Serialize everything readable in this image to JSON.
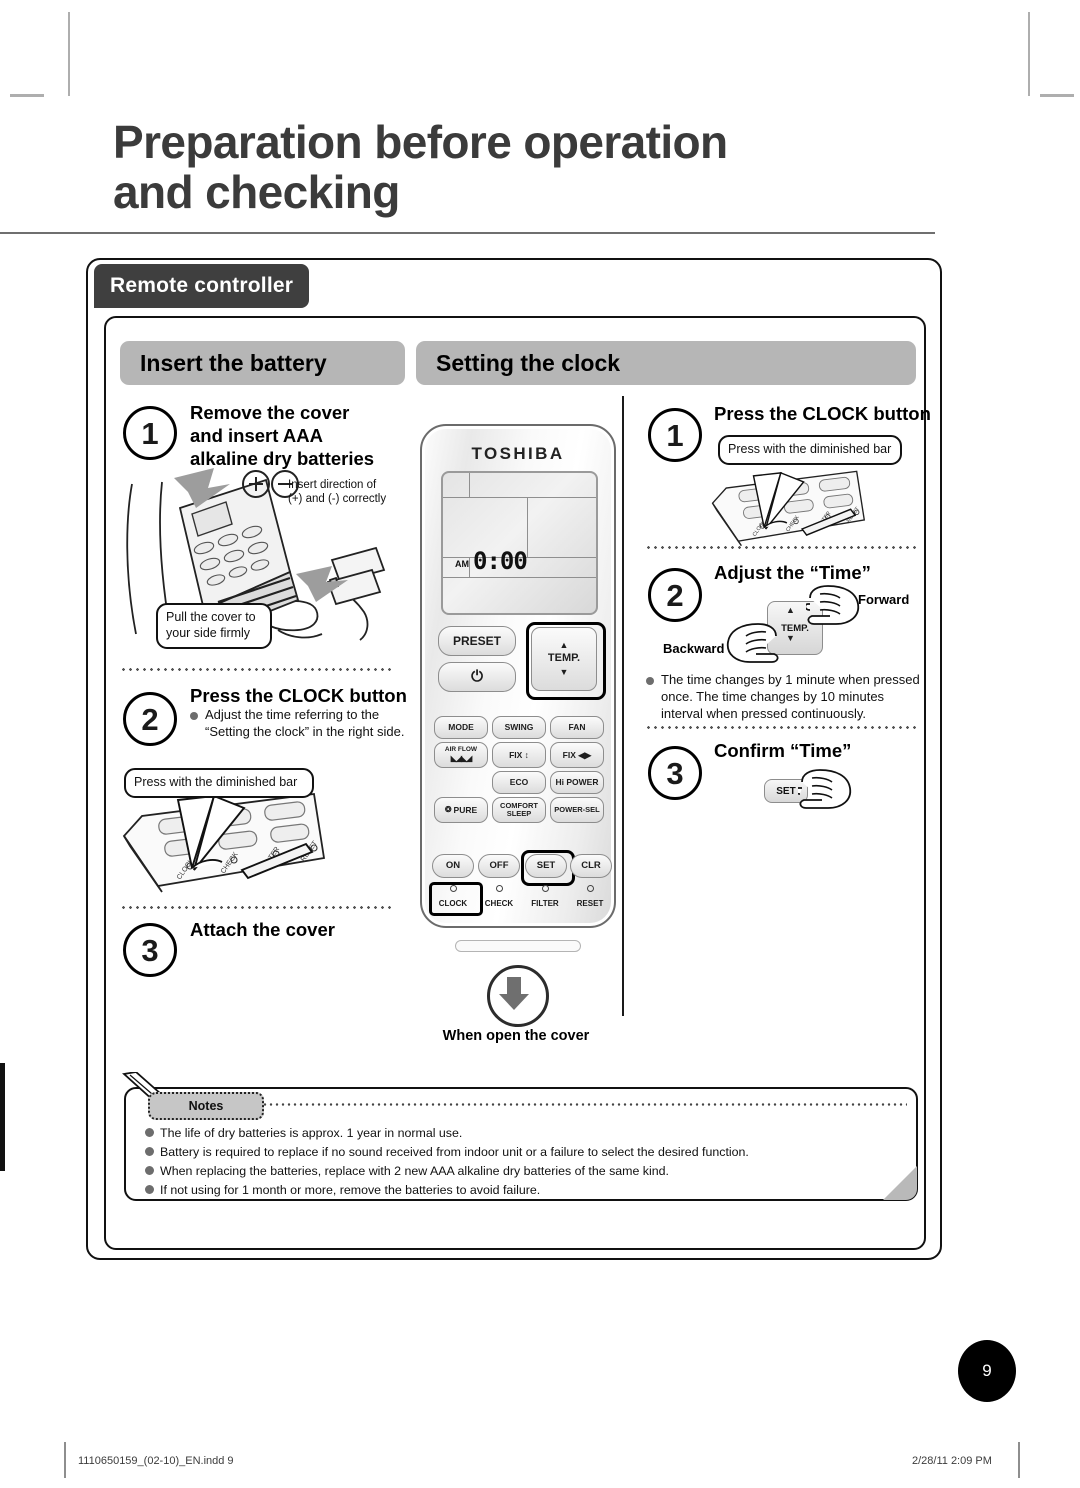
{
  "page": {
    "title_line1": "Preparation before operation",
    "title_line2": "and checking",
    "section_tab": "Remote controller",
    "page_number": "9"
  },
  "left_column": {
    "heading": "Insert the battery",
    "steps": [
      {
        "num": "1",
        "title": "Remove the cover\nand insert AAA\nalkaline dry batteries",
        "callout_polarity": "Insert direction of\n(+) and (-) correctly",
        "callout_pull": "Pull the cover to\nyour side firmly"
      },
      {
        "num": "2",
        "title": "Press the CLOCK button",
        "bullet": "Adjust the time referring to the\n“Setting the clock” in the right side.",
        "callout_press": "Press with the diminished bar"
      },
      {
        "num": "3",
        "title": "Attach the cover"
      }
    ]
  },
  "right_column": {
    "heading": "Setting the clock",
    "steps": [
      {
        "num": "1",
        "title": "Press the CLOCK button",
        "callout_press": "Press with the diminished bar"
      },
      {
        "num": "2",
        "title": "Adjust the “Time”",
        "label_forward": "Forward",
        "label_backward": "Backward",
        "button_label": "TEMP.",
        "bullet": "The time changes by 1 minute when pressed once. The time changes by 10 minutes interval when pressed continuously."
      },
      {
        "num": "3",
        "title": "Confirm “Time”",
        "button_label": "SET"
      }
    ]
  },
  "remote": {
    "brand": "TOSHIBA",
    "display": {
      "meridiem": "AM",
      "time": "0:00"
    },
    "primary_buttons": {
      "preset": "PRESET",
      "power_icon": "power-icon"
    },
    "temp_rocker": {
      "label": "TEMP.",
      "up": "▲",
      "down": "▼"
    },
    "keypad_rows": [
      [
        "MODE",
        "SWING",
        "FAN"
      ],
      [
        "AIR FLOW",
        "FIX ↕",
        "FIX ◀▶"
      ],
      [
        "",
        "ECO",
        "Hi POWER"
      ],
      [
        "PURE",
        "COMFORT\nSLEEP",
        "POWER-SEL"
      ]
    ],
    "timer_buttons": [
      "ON",
      "OFF",
      "SET",
      "CLR"
    ],
    "pinhole_labels": [
      "CLOCK",
      "CHECK",
      "FILTER",
      "RESET"
    ],
    "cover_caption": "When open the cover",
    "highlighted": [
      "SET",
      "CLOCK"
    ]
  },
  "notes": {
    "label": "Notes",
    "items": [
      "The life of dry batteries is approx. 1 year in normal use.",
      "Battery is required to replace if no sound received from indoor unit or a failure to select the desired function.",
      "When replacing the batteries, replace with 2 new AAA alkaline dry batteries of the same kind.",
      "If not using for 1 month or more, remove the batteries to avoid failure."
    ]
  },
  "print_footer": {
    "filename": "1110650159_(02-10)_EN.indd   9",
    "timestamp": "2/28/11   2:09 PM"
  },
  "colors": {
    "tab_dark": "#3f3f3f",
    "pill_gray": "#b6b6b6",
    "title_gray": "#3b3b3b",
    "bullet_gray": "#6d6d6d"
  }
}
